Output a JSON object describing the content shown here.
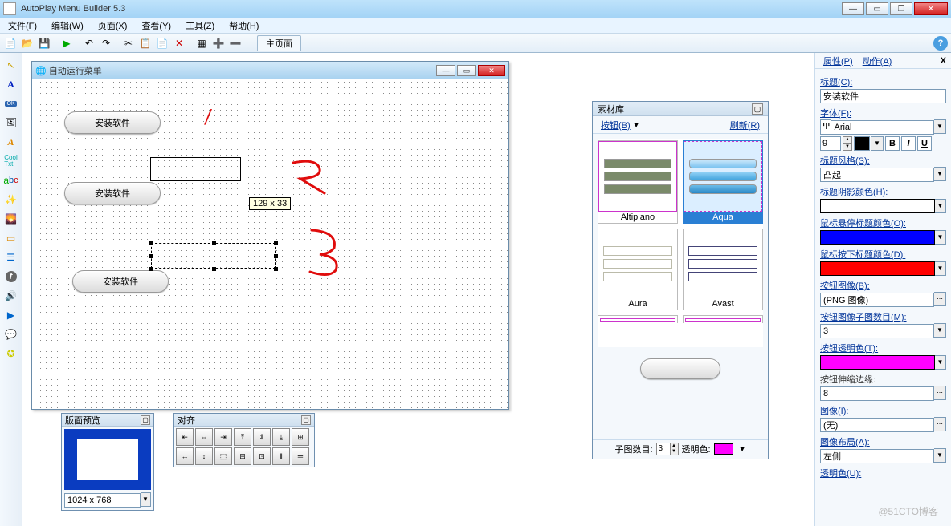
{
  "title": "AutoPlay Menu Builder 5.3",
  "menu": [
    "文件(F)",
    "编辑(W)",
    "页面(X)",
    "查看(Y)",
    "工具(Z)",
    "帮助(H)"
  ],
  "main_tab": "主页面",
  "design_window_title": "自动运行菜单",
  "buttons_label": "安装软件",
  "selection_size": "129 x 33",
  "preview_panel": {
    "title": "版面预览",
    "resolution": "1024 x 768"
  },
  "align_panel": {
    "title": "对齐"
  },
  "palette": {
    "title": "素材库",
    "btn_label": "按钮(B)",
    "refresh": "刷新(R)",
    "items": [
      "Altiplano",
      "Aqua",
      "Aura",
      "Avast"
    ],
    "sub_count_label": "子图数目:",
    "sub_count": "3",
    "trans_label": "透明色:"
  },
  "props": {
    "tab1": "属性(P)",
    "tab2": "动作(A)",
    "title_label": "标题(C):",
    "title_value": "安装软件",
    "font_label": "字体(F):",
    "font_value": "Arial",
    "font_size": "9",
    "style_label": "标题风格(S):",
    "style_value": "凸起",
    "shadow_label": "标题阴影颜色(H):",
    "hover_label": "鼠标悬停标题颜色(O):",
    "down_label": "鼠标按下标题颜色(D):",
    "img_label": "按钮图像(B):",
    "img_value": "(PNG 图像)",
    "subimg_label": "按钮图像子图数目(M):",
    "subimg_value": "3",
    "trans_label": "按钮透明色(T):",
    "shrink_label": "按钮伸缩边缘:",
    "shrink_value": "8",
    "image_label": "图像(I):",
    "image_value": "(无)",
    "layout_label": "图像布局(A):",
    "layout_value": "左侧",
    "transparent_label": "透明色(U):"
  },
  "watermark": "@51CTO博客"
}
